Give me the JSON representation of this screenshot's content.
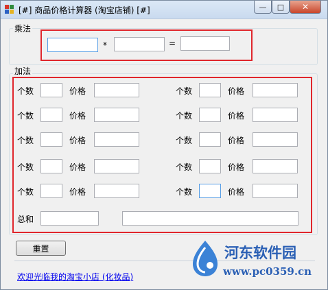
{
  "window": {
    "title": "[#] 商品价格计算器 (淘宝店铺) [#]",
    "controls": {
      "minimize": "—",
      "maximize": "□",
      "close": "✕"
    }
  },
  "multiply": {
    "group_label": "乘法",
    "operand1": "",
    "operator": "*",
    "operand2": "",
    "equals": "=",
    "result": ""
  },
  "addition": {
    "group_label": "加法",
    "qty_label": "个数",
    "price_label": "价格",
    "rows_left": [
      {
        "qty": "",
        "price": ""
      },
      {
        "qty": "",
        "price": ""
      },
      {
        "qty": "",
        "price": ""
      },
      {
        "qty": "",
        "price": ""
      },
      {
        "qty": "",
        "price": ""
      }
    ],
    "rows_right": [
      {
        "qty": "",
        "price": ""
      },
      {
        "qty": "",
        "price": ""
      },
      {
        "qty": "",
        "price": ""
      },
      {
        "qty": "",
        "price": ""
      },
      {
        "qty": "",
        "price": ""
      }
    ],
    "total_label": "总和",
    "total_value": "",
    "total_detail": ""
  },
  "reset_button": "重置",
  "shop_link": "欢迎光临我的淘宝小店 (化妆品)",
  "watermark": {
    "brand": "河东软件园",
    "url": "www.pc0359.cn"
  },
  "colors": {
    "highlight": "#e0262c",
    "link": "#0000ee",
    "watermark": "#2a5fb4"
  }
}
